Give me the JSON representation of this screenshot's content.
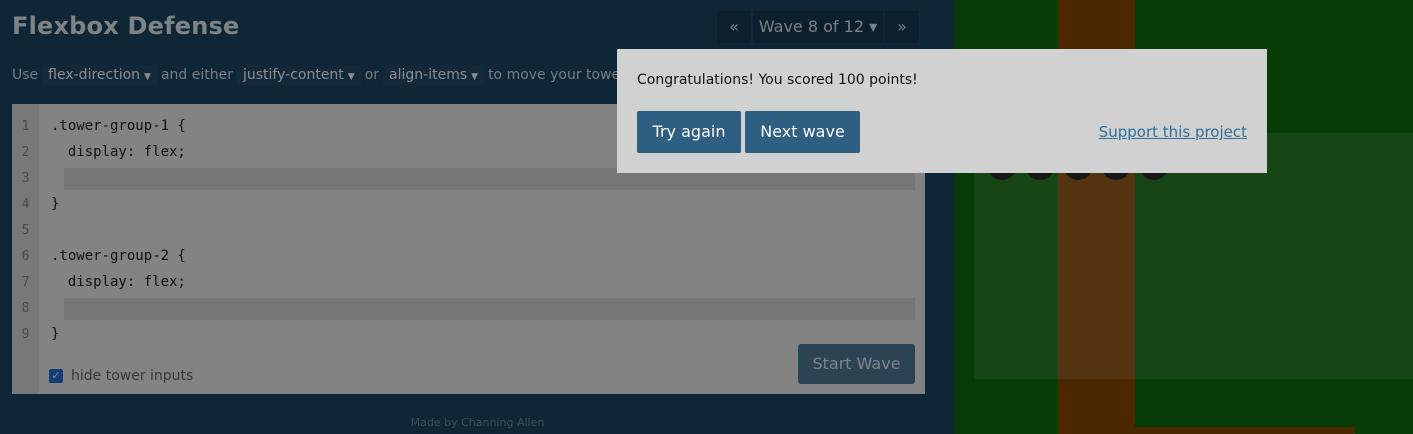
{
  "app": {
    "title": "Flexbox Defense"
  },
  "wave_nav": {
    "prev": "«",
    "label": "Wave 8 of 12",
    "caret": "▾",
    "next": "»"
  },
  "instructions": {
    "prefix": "Use",
    "selects": [
      "flex-direction",
      "justify-content",
      "align-items"
    ],
    "joiner1": "and either",
    "joiner2": "or",
    "suffix": "to move your towe"
  },
  "editor": {
    "line_numbers": [
      "1",
      "2",
      "3",
      "4",
      "5",
      "6",
      "7",
      "8",
      "9"
    ],
    "lines": [
      ".tower-group-1 {",
      "  display: flex;",
      "",
      "}",
      "",
      ".tower-group-2 {",
      "  display: flex;",
      "",
      "}"
    ],
    "hide_inputs_label": "hide tower inputs",
    "hide_inputs_checked": true,
    "start_button": "Start Wave"
  },
  "footer": {
    "credit": "Made by Channing Allen"
  },
  "modal": {
    "message": "Congratulations! You scored 100 points!",
    "try_again": "Try again",
    "next_wave": "Next wave",
    "support": "Support this project"
  },
  "colors": {
    "accent": "#2e5f82",
    "board_green": "#0b6f0b",
    "path_brown": "#8b4a00",
    "panel": "#1b4662"
  },
  "icons": {
    "prev": "chevron-double-left-icon",
    "next": "chevron-double-right-icon",
    "check": "check-icon"
  }
}
